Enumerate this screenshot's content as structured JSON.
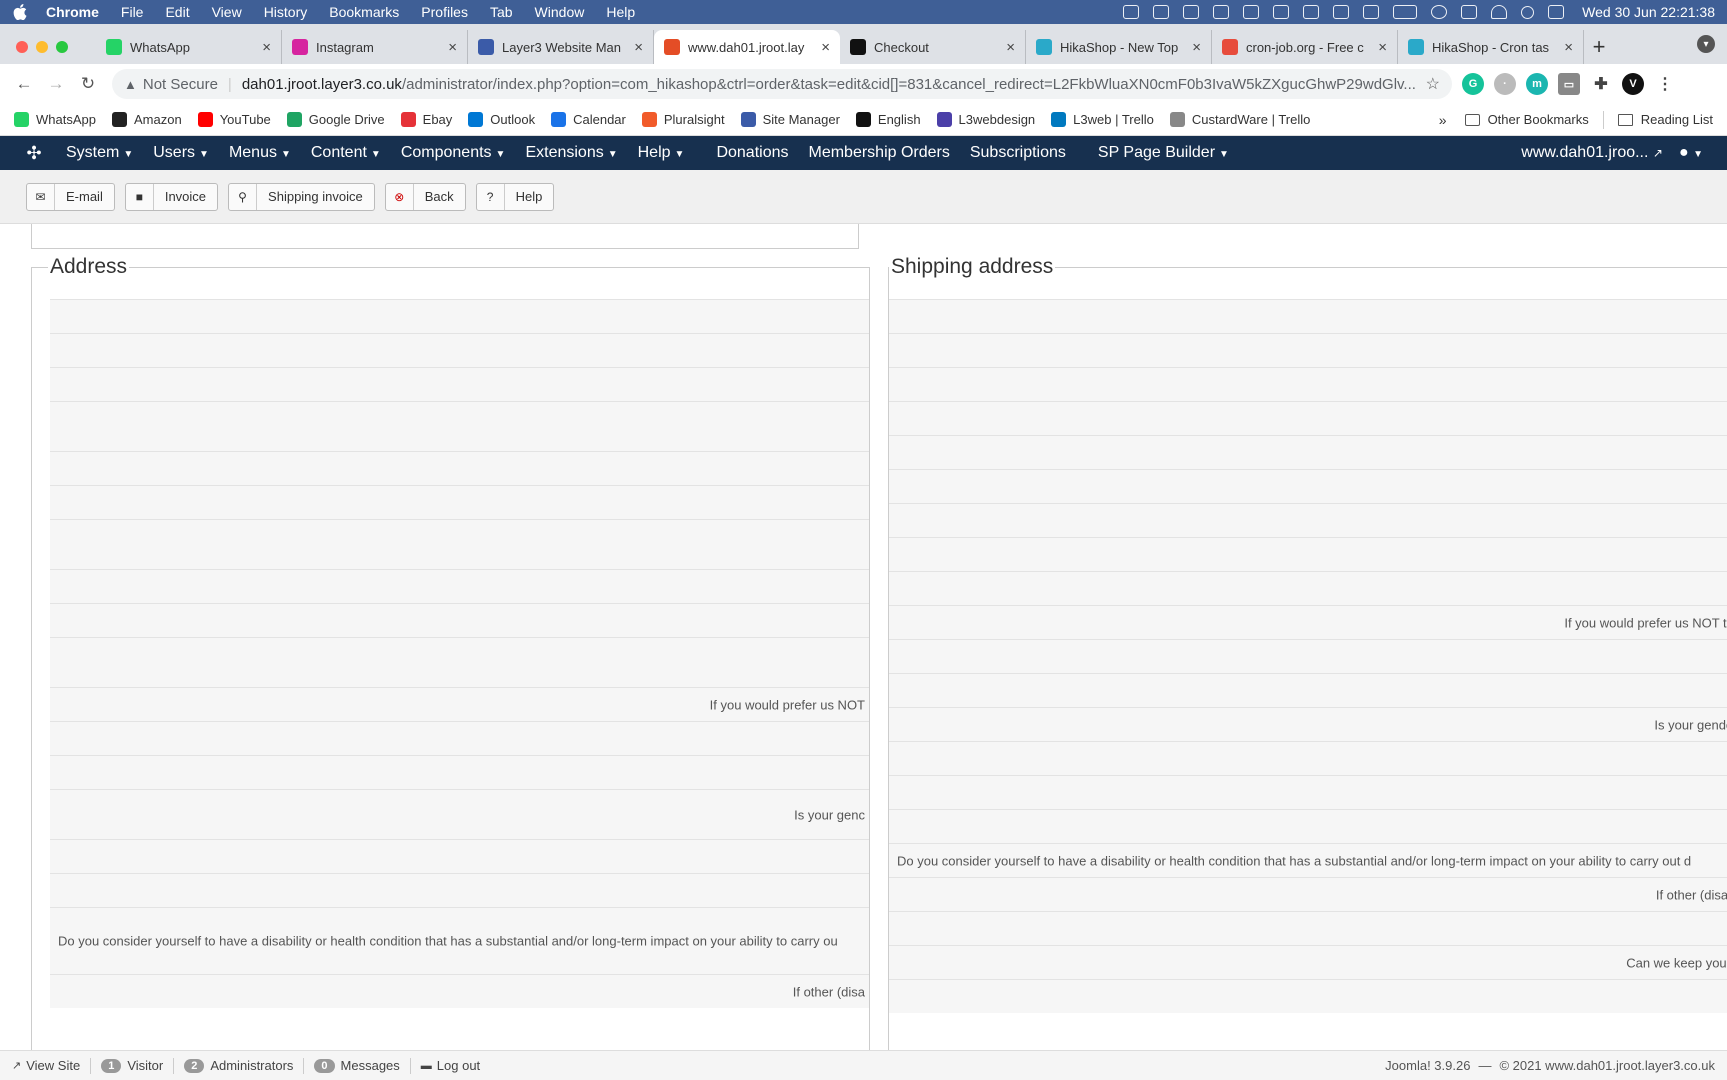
{
  "mac_menubar": {
    "app": "Chrome",
    "items": [
      "File",
      "Edit",
      "View",
      "History",
      "Bookmarks",
      "Profiles",
      "Tab",
      "Window",
      "Help"
    ],
    "clock": "Wed 30 Jun  22:21:38"
  },
  "tabs": [
    {
      "title": "WhatsApp",
      "icon": "whatsapp-icon",
      "color": "#25d366"
    },
    {
      "title": "Instagram",
      "icon": "instagram-icon",
      "color": "#d6249f"
    },
    {
      "title": "Layer3 Website Man",
      "icon": "layer3-icon",
      "color": "#3b5ba8"
    },
    {
      "title": "www.dah01.jroot.lay",
      "icon": "joomla-icon",
      "color": "#e44d26",
      "active": true
    },
    {
      "title": "Checkout",
      "icon": "checkout-icon",
      "color": "#111111"
    },
    {
      "title": "HikaShop - New Top",
      "icon": "hikashop-icon",
      "color": "#2aa9c9"
    },
    {
      "title": "cron-job.org - Free c",
      "icon": "cronjob-icon",
      "color": "#e74c3c"
    },
    {
      "title": "HikaShop - Cron tas",
      "icon": "hikashop-icon",
      "color": "#2aa9c9"
    }
  ],
  "omnibox": {
    "security": "Not Secure",
    "host": "dah01.jroot.layer3.co.uk",
    "path": "/administrator/index.php?option=com_hikashop&ctrl=order&task=edit&cid[]=831&cancel_redirect=L2FkbWluaXN0cmF0b3IvaW5kZXgucGhwP29wdGlv..."
  },
  "bookmarks": [
    {
      "label": "WhatsApp",
      "color": "#25d366"
    },
    {
      "label": "Amazon",
      "color": "#222222"
    },
    {
      "label": "YouTube",
      "color": "#ff0000"
    },
    {
      "label": "Google Drive",
      "color": "#1fa463"
    },
    {
      "label": "Ebay",
      "color": "#e53238"
    },
    {
      "label": "Outlook",
      "color": "#0078d4"
    },
    {
      "label": "Calendar",
      "color": "#1a73e8"
    },
    {
      "label": "Pluralsight",
      "color": "#f15b2a"
    },
    {
      "label": "Site Manager",
      "color": "#3b5ba8"
    },
    {
      "label": "English",
      "color": "#111111"
    },
    {
      "label": "L3webdesign",
      "color": "#4b3fa8"
    },
    {
      "label": "L3web | Trello",
      "color": "#0079bf"
    },
    {
      "label": "CustardWare | Trello",
      "color": "#888888"
    }
  ],
  "bookmarks_right": {
    "more": "»",
    "other": "Other Bookmarks",
    "reading": "Reading List"
  },
  "joomla_nav": {
    "dropdowns": [
      "System",
      "Users",
      "Menus",
      "Content",
      "Components",
      "Extensions",
      "Help"
    ],
    "links": [
      "Donations",
      "Membership Orders",
      "Subscriptions"
    ],
    "builder": "SP Page Builder",
    "site": "www.dah01.jroo..."
  },
  "toolbar_buttons": [
    {
      "label": "E-mail",
      "icon": "envelope-icon",
      "glyph": "✉"
    },
    {
      "label": "Invoice",
      "icon": "book-icon",
      "glyph": "■"
    },
    {
      "label": "Shipping invoice",
      "icon": "map-pin-icon",
      "glyph": "⚲"
    },
    {
      "label": "Back",
      "icon": "cancel-icon",
      "glyph": "⊗"
    },
    {
      "label": "Help",
      "icon": "question-icon",
      "glyph": "?"
    }
  ],
  "address": {
    "legend": "Address",
    "row_heights": [
      34,
      34,
      34,
      50,
      34,
      34,
      50,
      34,
      34,
      50,
      34,
      34,
      34,
      50,
      34,
      34,
      67,
      34
    ],
    "labels": [
      {
        "row": 10,
        "text": "If you would prefer us NOT",
        "align": "r"
      },
      {
        "row": 13,
        "text": "Is your genc",
        "align": "r"
      },
      {
        "row": 16,
        "text": "Do you consider yourself to have a disability or health condition that has a substantial and/or long-term impact on your ability to carry ou",
        "align": "l"
      },
      {
        "row": 17,
        "text": "If other (disa",
        "align": "r"
      }
    ]
  },
  "shipping": {
    "legend": "Shipping address",
    "row_heights": [
      34,
      34,
      34,
      34,
      34,
      34,
      34,
      34,
      34,
      34,
      34,
      34,
      34,
      34,
      34,
      34,
      34,
      34,
      34,
      34,
      34
    ],
    "labels": [
      {
        "row": 9,
        "text": "If you would prefer us NOT to c",
        "align": "r"
      },
      {
        "row": 12,
        "text": "Is your gender i",
        "align": "r"
      },
      {
        "row": 16,
        "text": "Do you consider yourself to have a disability or health condition that has a substantial and/or long-term impact on your ability to carry out d",
        "align": "l"
      },
      {
        "row": 17,
        "text": "If other (disabili",
        "align": "r"
      },
      {
        "row": 19,
        "text": "Can we keep you inf",
        "align": "r"
      }
    ]
  },
  "statusbar": {
    "view_site": "View Site",
    "visitors_count": "1",
    "visitors_label": "Visitor",
    "admins_count": "2",
    "admins_label": "Administrators",
    "messages_count": "0",
    "messages_label": "Messages",
    "logout": "Log out",
    "version": "Joomla! 3.9.26",
    "dash": "—",
    "copyright": "© 2021 www.dah01.jroot.layer3.co.uk"
  }
}
